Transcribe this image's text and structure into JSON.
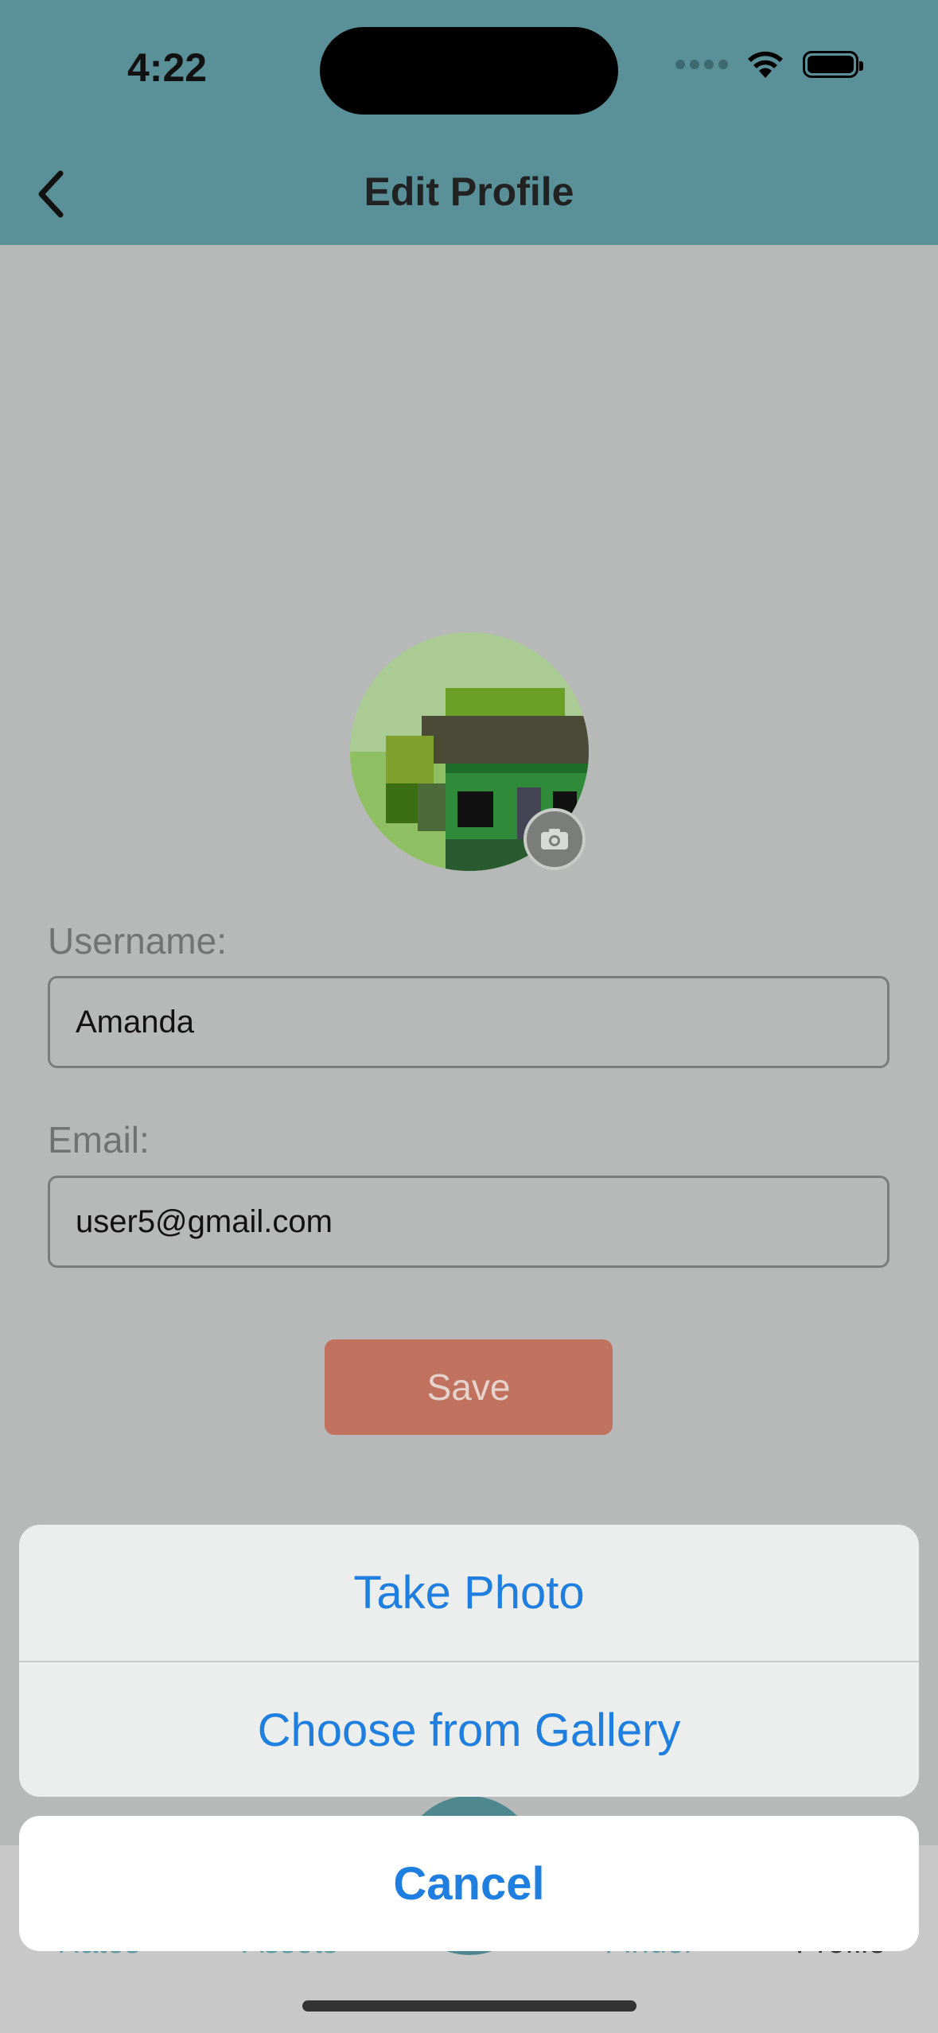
{
  "status": {
    "time": "4:22"
  },
  "header": {
    "title": "Edit Profile"
  },
  "form": {
    "username_label": "Username:",
    "username_value": "Amanda",
    "email_label": "Email:",
    "email_value": "user5@gmail.com",
    "save_label": "Save"
  },
  "tabbar": {
    "items": [
      "Rates",
      "Assets",
      "Finder",
      "Profile"
    ]
  },
  "action_sheet": {
    "take_photo": "Take Photo",
    "choose_gallery": "Choose from Gallery",
    "cancel": "Cancel"
  },
  "colors": {
    "header_bg": "#5a9199",
    "accent_blue": "#1f7fe0",
    "save_button": "#c1725f"
  }
}
